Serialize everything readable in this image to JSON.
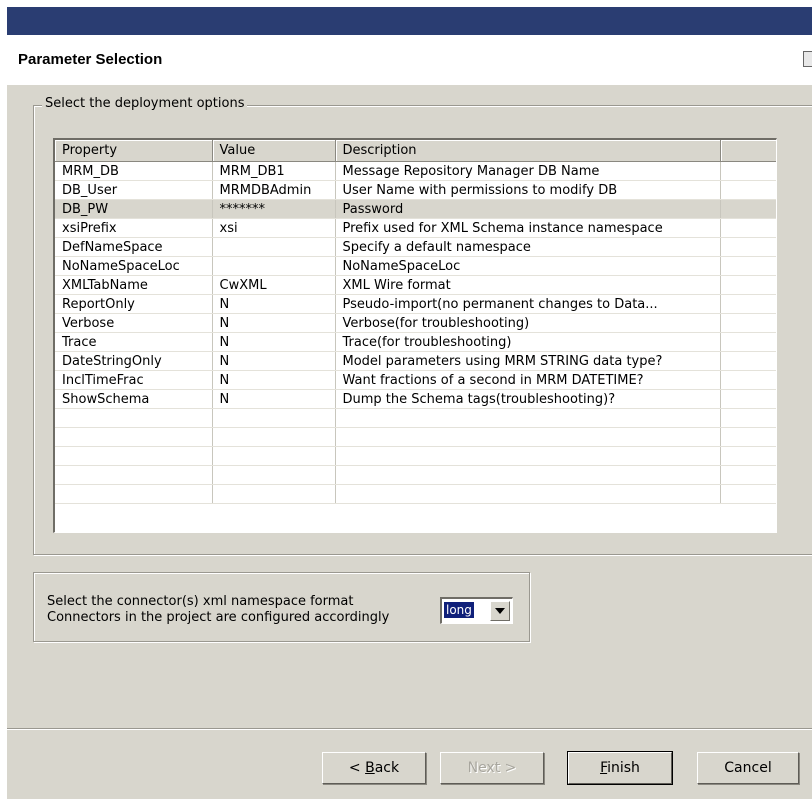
{
  "header": {
    "title": "Parameter Selection"
  },
  "deployment": {
    "group_label": "Select the deployment options",
    "columns": [
      "Property",
      "Value",
      "Description",
      ""
    ],
    "rows": [
      {
        "property": "MRM_DB",
        "value": "MRM_DB1",
        "description": "Message Repository Manager DB Name"
      },
      {
        "property": "DB_User",
        "value": "MRMDBAdmin",
        "description": "User Name with permissions to modify DB"
      },
      {
        "property": "DB_PW",
        "value": "*******",
        "description": "Password",
        "selected": true
      },
      {
        "property": "xsiPrefix",
        "value": "xsi",
        "description": "Prefix used for XML Schema instance namespace"
      },
      {
        "property": "DefNameSpace",
        "value": "",
        "description": "Specify a default namespace"
      },
      {
        "property": "NoNameSpaceLoc",
        "value": "",
        "description": "NoNameSpaceLoc"
      },
      {
        "property": "XMLTabName",
        "value": "CwXML",
        "description": "XML  Wire format"
      },
      {
        "property": "ReportOnly",
        "value": "N",
        "description": "Pseudo-import(no permanent changes to Data..."
      },
      {
        "property": "Verbose",
        "value": "N",
        "description": "Verbose(for troubleshooting)"
      },
      {
        "property": "Trace",
        "value": "N",
        "description": "Trace(for troubleshooting)"
      },
      {
        "property": "DateStringOnly",
        "value": "N",
        "description": "Model parameters using MRM STRING data type?"
      },
      {
        "property": "InclTimeFrac",
        "value": "N",
        "description": "Want fractions of a second in MRM DATETIME?"
      },
      {
        "property": "ShowSchema",
        "value": "N",
        "description": "Dump the Schema tags(troubleshooting)?"
      },
      {
        "property": "",
        "value": "",
        "description": ""
      },
      {
        "property": "",
        "value": "",
        "description": ""
      },
      {
        "property": "",
        "value": "",
        "description": ""
      },
      {
        "property": "",
        "value": "",
        "description": ""
      },
      {
        "property": "",
        "value": "",
        "description": ""
      }
    ]
  },
  "namespace": {
    "line1": "Select the connector(s) xml namespace format",
    "line2": "Connectors in the project are configured accordingly",
    "selected": "long"
  },
  "buttons": {
    "back_prefix": "< ",
    "back_mnemonic": "B",
    "back_rest": "ack",
    "next": "Next >",
    "finish_mnemonic": "F",
    "finish_rest": "inish",
    "cancel": "Cancel"
  },
  "colors": {
    "title_bar": "#2a3d72",
    "panel": "#d8d6cd",
    "selection": "#10207a"
  }
}
